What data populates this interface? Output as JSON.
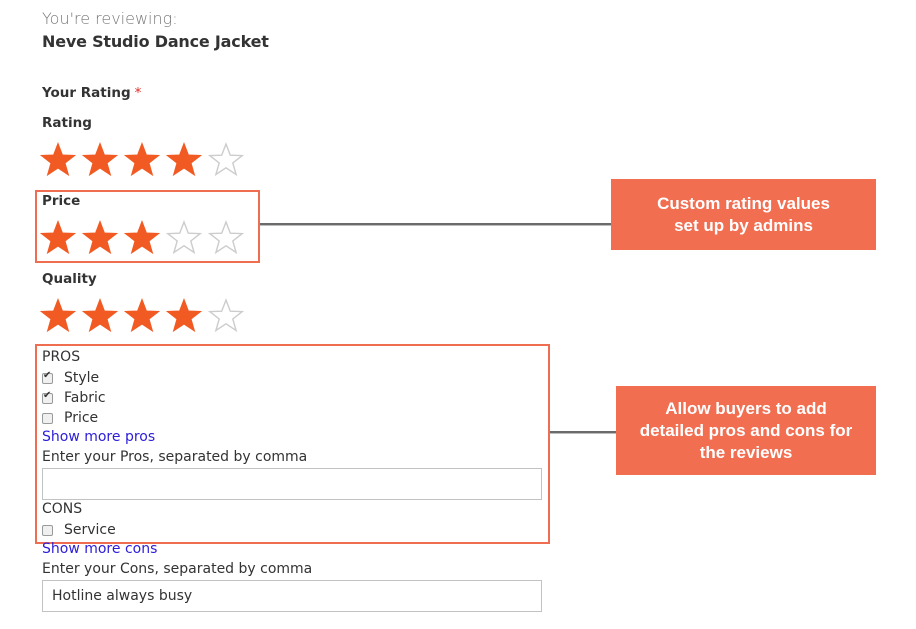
{
  "header": {
    "reviewing_label": "You're reviewing:",
    "product_name": "Neve Studio Dance Jacket"
  },
  "rating_section": {
    "title": "Your Rating",
    "required_mark": "*",
    "ratings": [
      {
        "label": "Rating",
        "value": 4,
        "max": 5
      },
      {
        "label": "Price",
        "value": 3,
        "max": 5
      },
      {
        "label": "Quality",
        "value": 4,
        "max": 5
      }
    ]
  },
  "pros": {
    "title": "PROS",
    "options": [
      {
        "label": "Style",
        "checked": true
      },
      {
        "label": "Fabric",
        "checked": true
      },
      {
        "label": "Price",
        "checked": false
      }
    ],
    "show_more_label": "Show more pros",
    "input_label": "Enter your Pros, separated by comma",
    "input_value": ""
  },
  "cons": {
    "title": "CONS",
    "options": [
      {
        "label": "Service",
        "checked": false
      }
    ],
    "show_more_label": "Show more cons",
    "input_label": "Enter your Cons, separated by comma",
    "input_value": "Hotline always busy"
  },
  "callouts": [
    {
      "lines": [
        "Custom rating values",
        "set up by admins"
      ]
    },
    {
      "lines": [
        "Allow buyers to add",
        "detailed pros and cons for",
        "the reviews"
      ]
    }
  ],
  "colors": {
    "star_filled": "#f15a22",
    "star_empty": "#cccccc",
    "highlight": "#ef6e51",
    "callout_bg": "#f16e51",
    "link": "#2b1dd8"
  }
}
